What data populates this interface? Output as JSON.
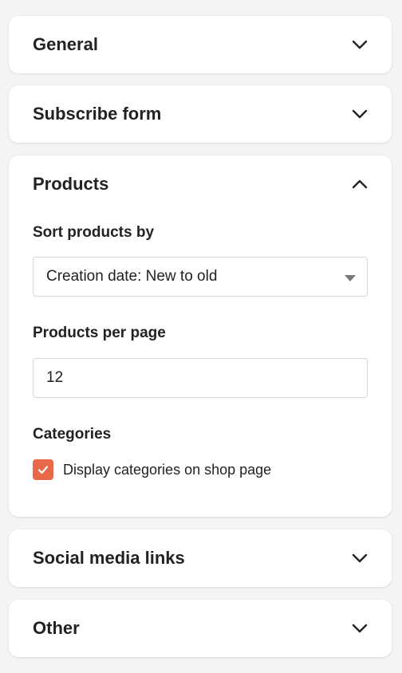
{
  "panels": {
    "general": {
      "title": "General"
    },
    "subscribe": {
      "title": "Subscribe form"
    },
    "products": {
      "title": "Products",
      "sort_label": "Sort products by",
      "sort_value": "Creation date: New to old",
      "per_page_label": "Products per page",
      "per_page_value": "12",
      "categories_label": "Categories",
      "display_categories_label": "Display categories on shop page",
      "display_categories_checked": true
    },
    "social": {
      "title": "Social media links"
    },
    "other": {
      "title": "Other"
    }
  },
  "icons": {
    "collapsed": "chevron-down-icon",
    "expanded": "chevron-up-icon",
    "check": "check-icon",
    "dropdown": "caret-down-icon"
  },
  "colors": {
    "accent": "#e8694a",
    "background": "#f4f4f4",
    "panel": "#ffffff",
    "text": "#222222"
  }
}
